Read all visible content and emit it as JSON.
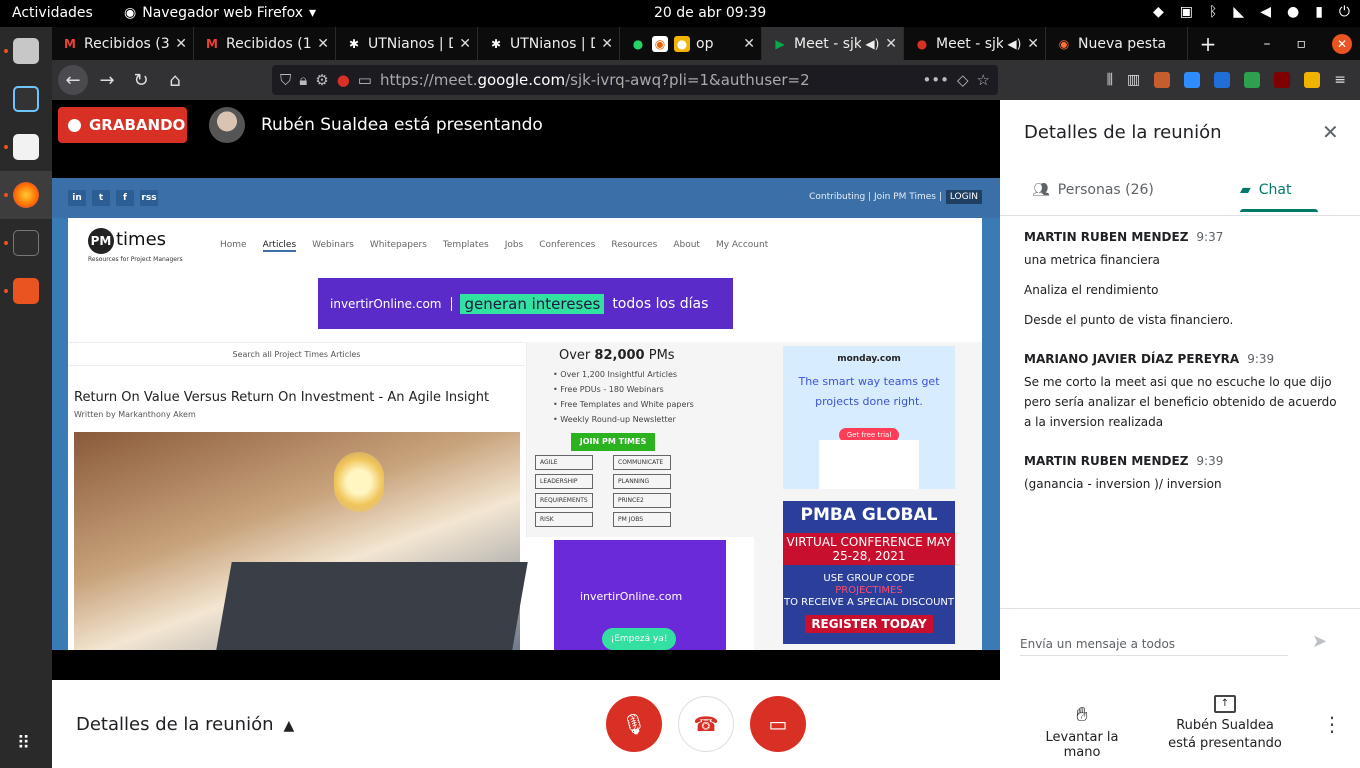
{
  "os": {
    "activities": "Actividades",
    "app_name": "Navegador web Firefox",
    "clock": "20 de abr  09:39"
  },
  "browser": {
    "tabs": [
      {
        "title": "Recibidos (3",
        "icon": "gmail-icon"
      },
      {
        "title": "Recibidos (1",
        "icon": "gmail-icon"
      },
      {
        "title": "UTNianos | D",
        "icon": "utn-icon"
      },
      {
        "title": "UTNianos | D",
        "icon": "utn-icon"
      },
      {
        "title": "op",
        "icon": "whatsapp-icon"
      },
      {
        "title": "Meet - sjk",
        "icon": "meet-icon"
      },
      {
        "title": "Meet - sjk",
        "icon": "mic-icon"
      },
      {
        "title": "Nueva pesta",
        "icon": "firefox-icon"
      }
    ],
    "url_prefix": "https://meet.",
    "url_domain": "google.com",
    "url_suffix": "/sjk-ivrq-awq?pli=1&authuser=2"
  },
  "meet": {
    "recording_label": "GRABANDO",
    "presenter_text": "Rubén Sualdea está presentando",
    "shared_screen": {
      "social": [
        "in",
        "t",
        "f",
        "rss"
      ],
      "top_links": "Contributing | Join PM Times |",
      "login": "LOGIN",
      "logo_name": "times",
      "logo_pm": "PM",
      "logo_tagline": "Resources for Project Managers",
      "nav": [
        "Home",
        "Articles",
        "Webinars",
        "Whitepapers",
        "Templates",
        "Jobs",
        "Conferences",
        "Resources",
        "About",
        "My Account"
      ],
      "ad_brand": "invertirOnline.com",
      "ad_highlight": "generan intereses",
      "ad_tail": "todos los días",
      "search": "Search all Project Times Articles",
      "article_title": "Return On Value Versus Return On Investment - An Agile Insight",
      "article_author": "Written by Markanthony Akem",
      "over_pre": "Over",
      "over_num": "82,000",
      "over_post": "PMs",
      "bullets": [
        "Over 1,200 Insightful Articles",
        "Free PDUs - 180 Webinars",
        "Free Templates and White papers",
        "Weekly Round-up Newsletter"
      ],
      "join": "JOIN PM TIMES",
      "tags": [
        "AGILE",
        "COMMUNICATE",
        "LEADERSHIP",
        "PLANNING",
        "REQUIREMENTS",
        "PRINCE2",
        "RISK",
        "PM JOBS"
      ],
      "ad2_brand": "invertirOnline.com",
      "ad2_btn": "¡Empezá ya!",
      "monday_logo": "monday.com",
      "monday_text": "The smart way teams get projects done right.",
      "monday_btn": "Get free trial",
      "pmba_title": "PMBA GLOBAL",
      "pmba_vc": "VIRTUAL CONFERENCE MAY 25-28, 2021",
      "pmba_code": "USE GROUP CODE",
      "pmba_code_val": "PROJECTIMES",
      "pmba_discount": "TO RECEIVE A SPECIAL DISCOUNT",
      "pmba_register": "REGISTER TODAY"
    }
  },
  "controls": {
    "details_label": "Detalles de la reunión",
    "raise_hand": "Levantar la mano",
    "presenting_1": "Rubén Sualdea",
    "presenting_2": "está presentando"
  },
  "panel": {
    "title": "Detalles de la reunión",
    "people_tab": "Personas (26)",
    "chat_tab": "Chat",
    "messages": [
      {
        "sender": "MARTIN RUBEN MENDEZ",
        "time": "9:37",
        "lines": [
          "una metrica financiera",
          "Analiza el rendimiento",
          "Desde el punto de vista financiero."
        ]
      },
      {
        "sender": "MARIANO JAVIER DÍAZ PEREYRA",
        "time": "9:39",
        "lines": [
          "Se me corto la meet asi que no escuche lo que dijo pero sería analizar el beneficio obtenido de acuerdo a la inversion realizada"
        ]
      },
      {
        "sender": "MARTIN RUBEN MENDEZ",
        "time": "9:39",
        "lines": [
          "(ganancia - inversion )/ inversion"
        ]
      }
    ],
    "send_placeholder": "Envía un mensaje a todos"
  },
  "colors": {
    "accent_red": "#d93025",
    "chat_teal": "#00796b",
    "ubuntu_orange": "#e95420"
  }
}
